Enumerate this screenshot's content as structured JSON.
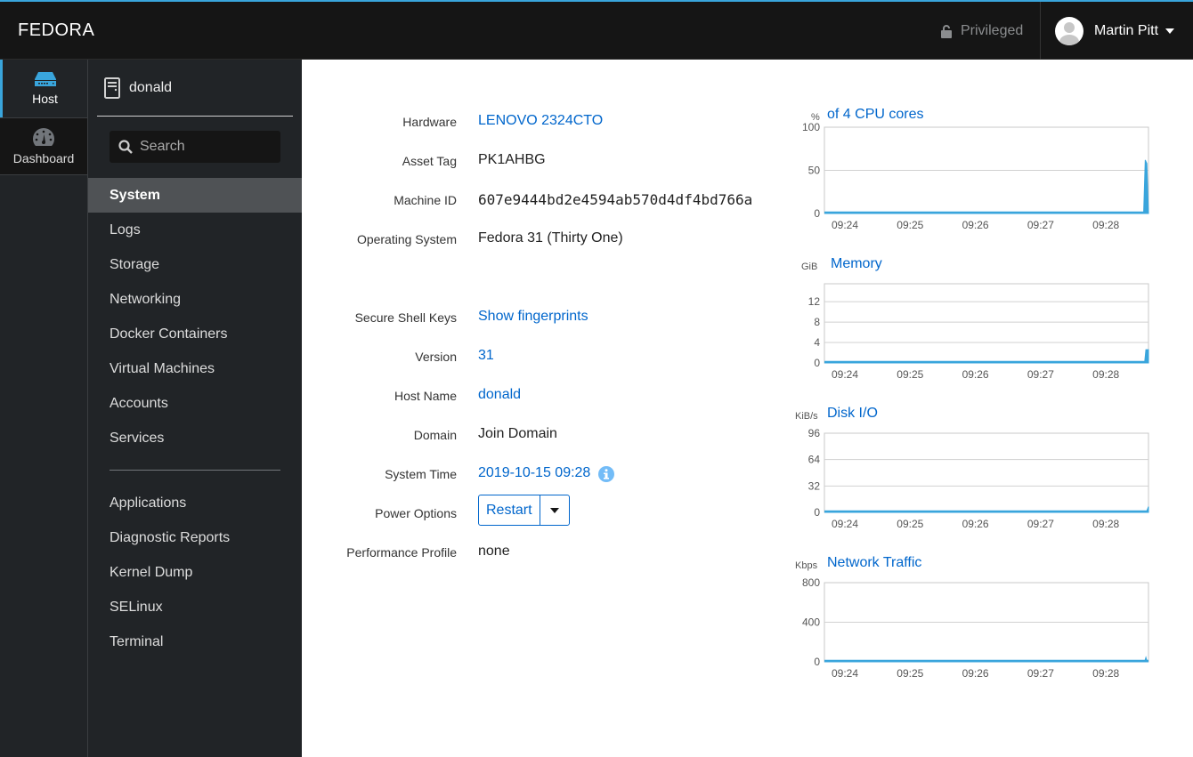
{
  "topbar": {
    "brand": "FEDORA",
    "privileged_label": "Privileged",
    "user_name": "Martin Pitt",
    "accent_color": "#39a5dc"
  },
  "leftnav": {
    "items": [
      {
        "label": "Host",
        "icon": "host-icon",
        "active": true
      },
      {
        "label": "Dashboard",
        "icon": "dashboard-icon",
        "active": false
      }
    ]
  },
  "subnav": {
    "hostname": "donald",
    "search_placeholder": "Search",
    "items": [
      {
        "label": "System",
        "active": true
      },
      {
        "label": "Logs"
      },
      {
        "label": "Storage"
      },
      {
        "label": "Networking"
      },
      {
        "label": "Docker Containers"
      },
      {
        "label": "Virtual Machines"
      },
      {
        "label": "Accounts"
      },
      {
        "label": "Services"
      }
    ],
    "tools": [
      {
        "label": "Applications"
      },
      {
        "label": "Diagnostic Reports"
      },
      {
        "label": "Kernel Dump"
      },
      {
        "label": "SELinux"
      },
      {
        "label": "Terminal"
      }
    ]
  },
  "system": {
    "hardware": {
      "label": "Hardware",
      "value": "LENOVO 2324CTO"
    },
    "asset_tag": {
      "label": "Asset Tag",
      "value": "PK1AHBG"
    },
    "machine_id": {
      "label": "Machine ID",
      "value": "607e9444bd2e4594ab570d4df4bd766a"
    },
    "os": {
      "label": "Operating System",
      "value": "Fedora 31 (Thirty One)"
    },
    "ssh_keys": {
      "label": "Secure Shell Keys",
      "value": "Show fingerprints"
    },
    "version": {
      "label": "Version",
      "value": "31"
    },
    "host_name": {
      "label": "Host Name",
      "value": "donald"
    },
    "domain": {
      "label": "Domain",
      "value": "Join Domain"
    },
    "system_time": {
      "label": "System Time",
      "value": "2019-10-15 09:28"
    },
    "power": {
      "label": "Power Options",
      "value": "Restart"
    },
    "perf_profile": {
      "label": "Performance Profile",
      "value": "none"
    }
  },
  "chart_data": [
    {
      "type": "area",
      "title": "of 4 CPU cores",
      "ylabel": "%",
      "ylim": [
        0,
        100
      ],
      "yticks": [
        "100",
        "50",
        "0"
      ],
      "ytick_values": [
        100,
        50,
        0
      ],
      "xticks": [
        "09:24",
        "09:25",
        "09:26",
        "09:27",
        "09:28"
      ],
      "grid": true,
      "series": [
        {
          "name": "cpu",
          "x": [
            0,
            0.985,
            0.99,
            0.995,
            1.0
          ],
          "values": [
            0,
            0,
            62,
            58,
            0
          ]
        }
      ]
    },
    {
      "type": "area",
      "title": "Memory",
      "ylabel": "GiB",
      "ylim": [
        0,
        15.5
      ],
      "yticks": [
        "12",
        "8",
        "4",
        "0"
      ],
      "ytick_values": [
        12,
        8,
        4,
        0
      ],
      "xticks": [
        "09:24",
        "09:25",
        "09:26",
        "09:27",
        "09:28"
      ],
      "grid": true,
      "series": [
        {
          "name": "memory",
          "x": [
            0,
            0.988,
            0.992,
            1.0
          ],
          "values": [
            0,
            0,
            2.6,
            2.6
          ]
        }
      ]
    },
    {
      "type": "area",
      "title": "Disk I/O",
      "ylabel": "KiB/s",
      "ylim": [
        0,
        96
      ],
      "yticks": [
        "96",
        "64",
        "32",
        "0"
      ],
      "ytick_values": [
        96,
        64,
        32,
        0
      ],
      "xticks": [
        "09:24",
        "09:25",
        "09:26",
        "09:27",
        "09:28"
      ],
      "grid": true,
      "series": [
        {
          "name": "disk",
          "x": [
            0,
            0.993,
            1.0
          ],
          "values": [
            0,
            0,
            7
          ]
        }
      ]
    },
    {
      "type": "area",
      "title": "Network Traffic",
      "ylabel": "Kbps",
      "ylim": [
        0,
        800
      ],
      "yticks": [
        "800",
        "400",
        "0"
      ],
      "ytick_values": [
        800,
        400,
        0
      ],
      "xticks": [
        "09:24",
        "09:25",
        "09:26",
        "09:27",
        "09:28"
      ],
      "grid": true,
      "series": [
        {
          "name": "network",
          "x": [
            0,
            0.988,
            0.992,
            0.996,
            1.0
          ],
          "values": [
            0,
            0,
            45,
            0,
            0
          ]
        }
      ]
    }
  ]
}
